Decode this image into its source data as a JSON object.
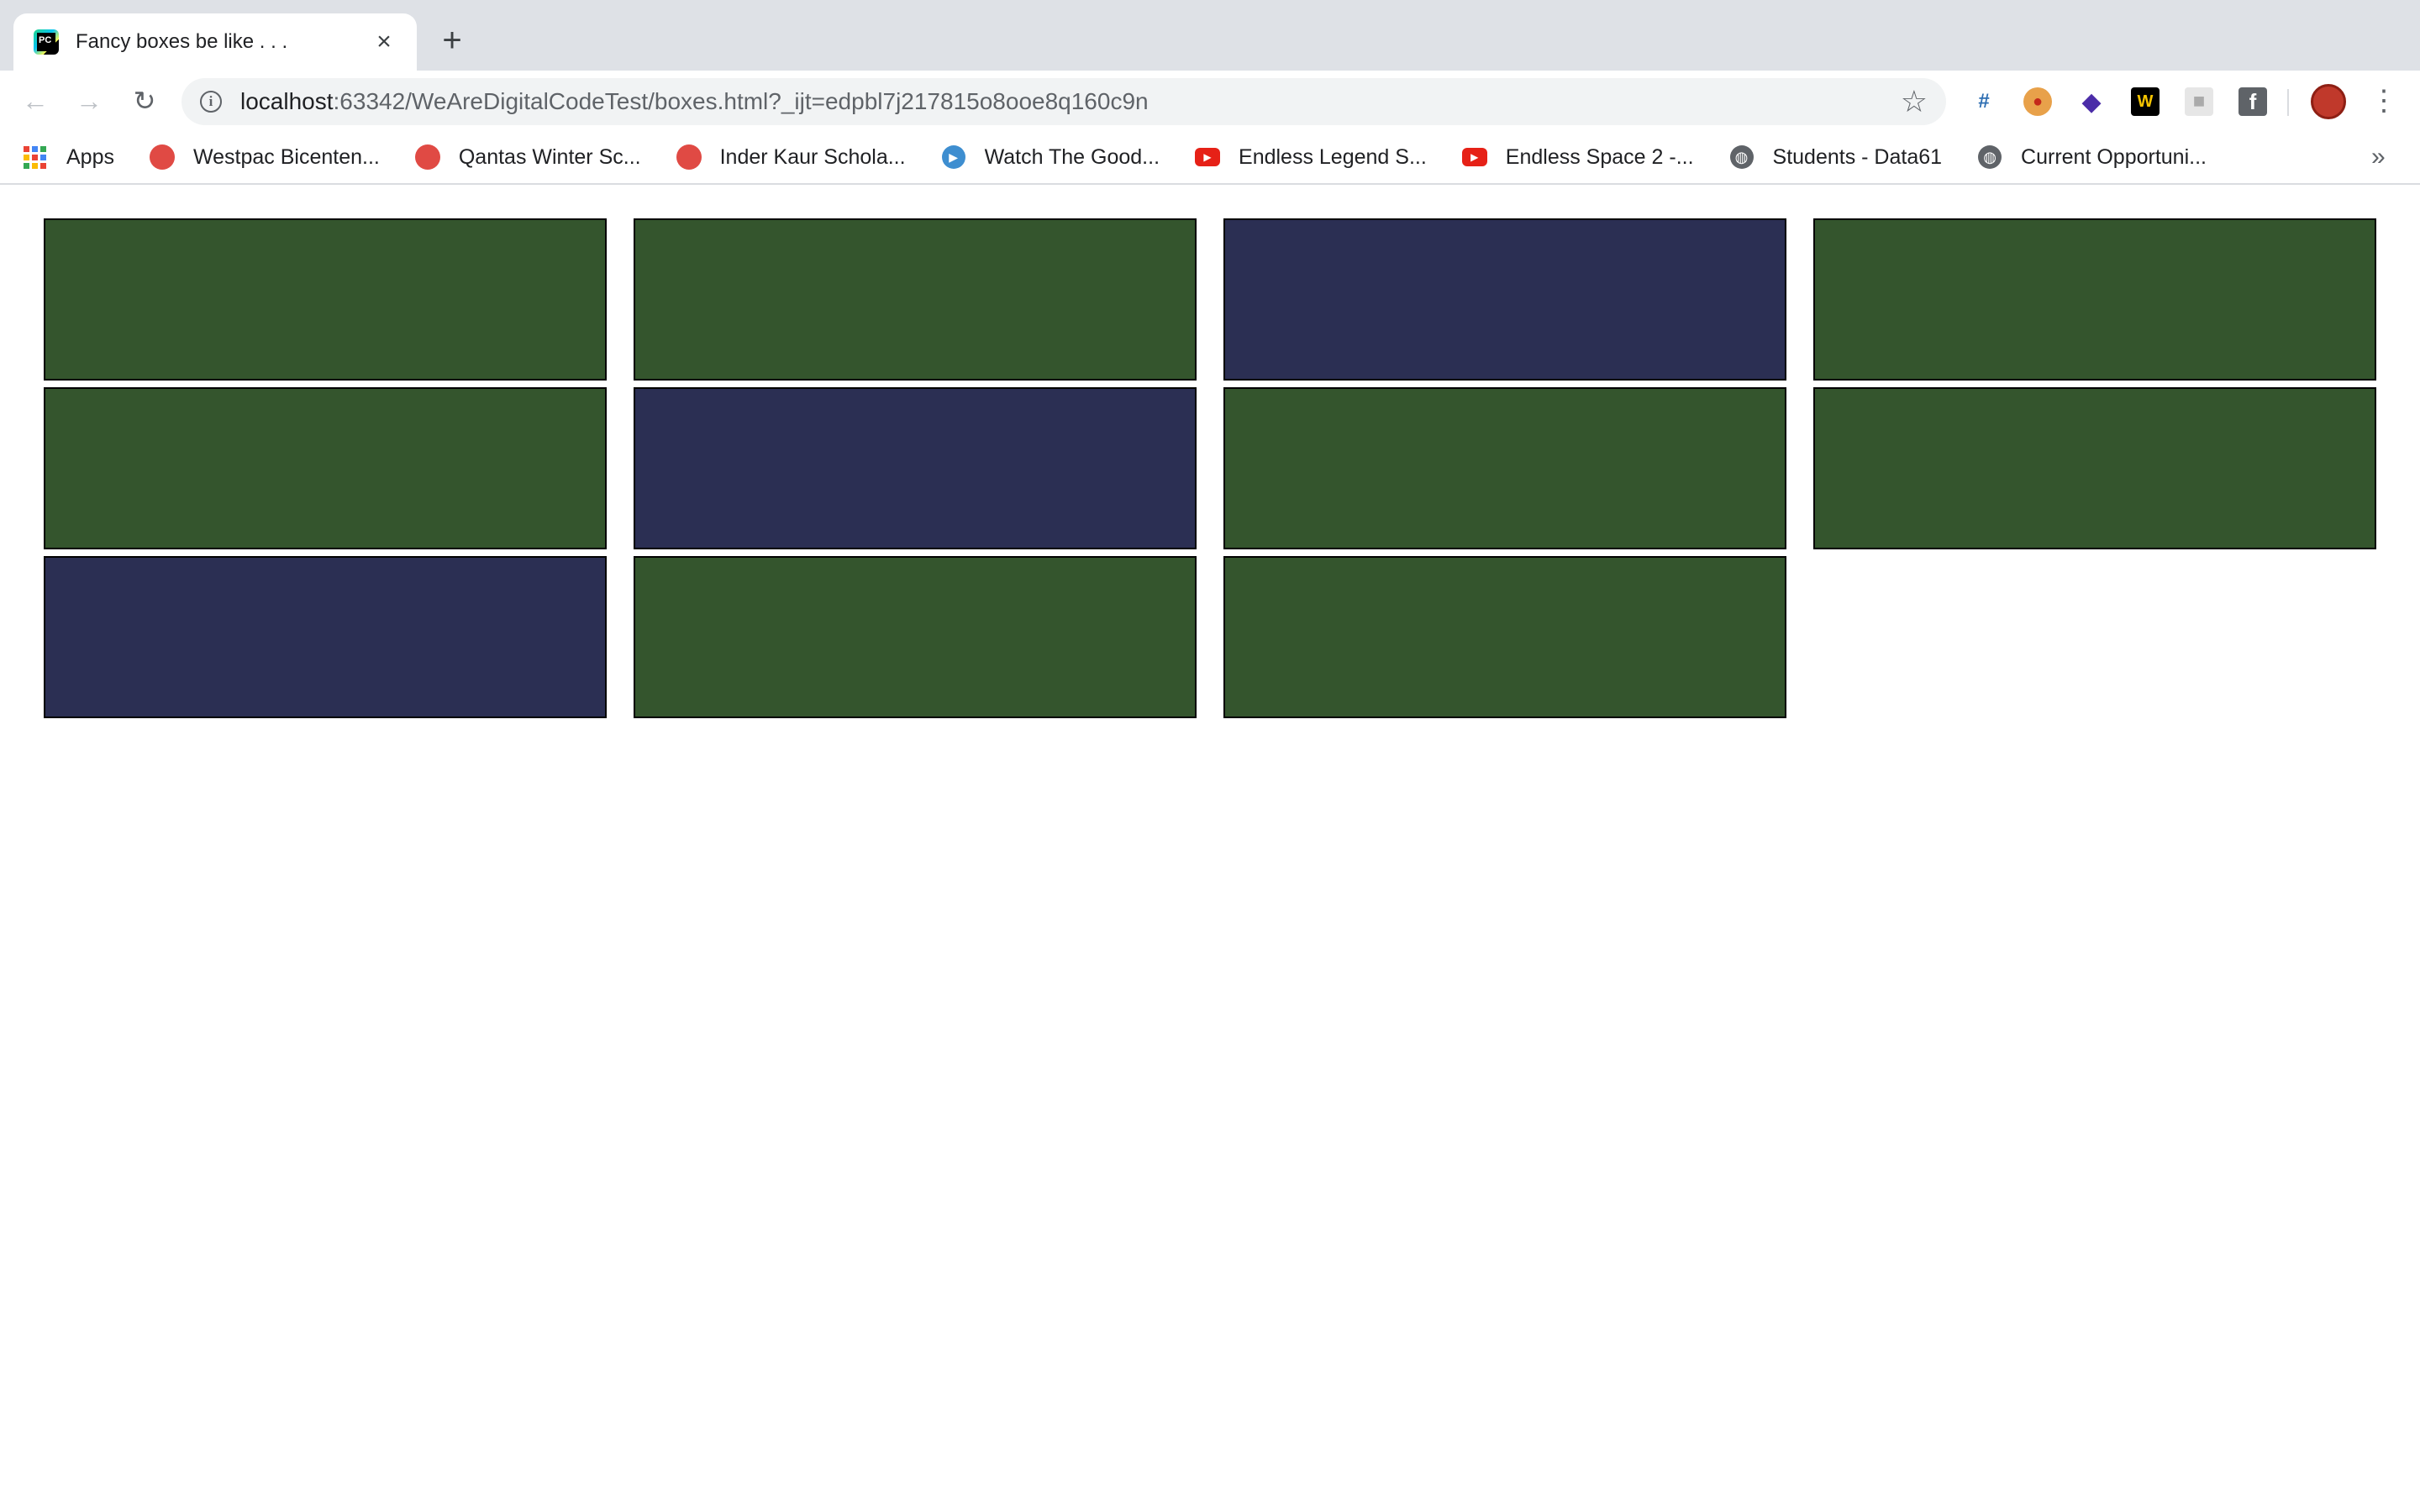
{
  "tab": {
    "favicon_text": "PC",
    "title": "Fancy boxes be like . . .",
    "close_icon": "×",
    "new_tab_icon": "+"
  },
  "toolbar": {
    "back_icon": "←",
    "forward_icon": "→",
    "reload_icon": "↻",
    "info_icon": "i",
    "url_host": "localhost",
    "url_rest": ":63342/WeAreDigitalCodeTest/boxes.html?_ijt=edpbl7j217815o8ooe8q160c9n",
    "bookmark_star_icon": "☆",
    "extensions": [
      {
        "name": "crop-extension",
        "glyph": "#"
      },
      {
        "name": "santa-extension",
        "glyph": "●"
      },
      {
        "name": "layers-extension",
        "glyph": "◆"
      },
      {
        "name": "w-extension",
        "glyph": "W"
      },
      {
        "name": "grey-extension",
        "glyph": "■"
      },
      {
        "name": "facebook-extension",
        "glyph": "f"
      }
    ],
    "menu_icon": "⋮"
  },
  "bookmarks": {
    "apps_label": "Apps",
    "apps_colors": [
      "#ea4335",
      "#4285f4",
      "#34a853",
      "#fbbc05",
      "#ea4335",
      "#4285f4",
      "#34a853",
      "#fbbc05",
      "#ea4335"
    ],
    "items": [
      {
        "icon": "red-blob-icon",
        "label": "Westpac Bicenten..."
      },
      {
        "icon": "red-blob-icon",
        "label": "Qantas Winter Sc..."
      },
      {
        "icon": "red-blob-icon",
        "label": "Inder Kaur Schola..."
      },
      {
        "icon": "play-icon",
        "label": "Watch The Good..."
      },
      {
        "icon": "youtube-icon",
        "label": "Endless Legend S..."
      },
      {
        "icon": "youtube-icon",
        "label": "Endless Space 2 -..."
      },
      {
        "icon": "globe-icon",
        "label": "Students - Data61"
      },
      {
        "icon": "globe-icon",
        "label": "Current Opportuni..."
      }
    ],
    "more_icon": "»"
  },
  "colors": {
    "green": "#34552d",
    "navy": "#2b2f53"
  },
  "boxes": [
    "green",
    "green",
    "navy",
    "green",
    "green",
    "navy",
    "green",
    "green",
    "navy",
    "green",
    "green"
  ]
}
